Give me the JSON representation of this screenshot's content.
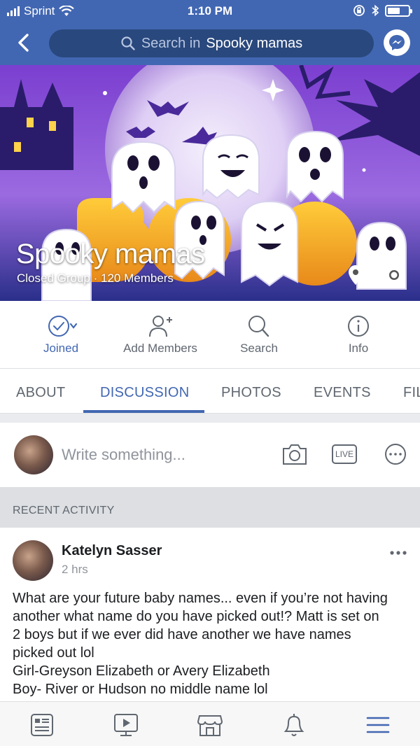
{
  "status_bar": {
    "carrier": "Sprint",
    "time": "1:10 PM",
    "battery_level": 0.6
  },
  "nav": {
    "search_prefix": "Search in",
    "search_group": "Spooky mamas"
  },
  "group": {
    "name": "Spooky mamas",
    "meta": "Closed Group · 120 Members"
  },
  "actions": [
    {
      "label": "Joined",
      "icon": "check-circle-icon"
    },
    {
      "label": "Add Members",
      "icon": "add-person-icon"
    },
    {
      "label": "Search",
      "icon": "search-icon"
    },
    {
      "label": "Info",
      "icon": "info-icon"
    }
  ],
  "tabs": [
    "ABOUT",
    "DISCUSSION",
    "PHOTOS",
    "EVENTS",
    "FIL"
  ],
  "active_tab": "DISCUSSION",
  "composer": {
    "placeholder": "Write something...",
    "live_label": "LIVE"
  },
  "recent_activity": "RECENT ACTIVITY",
  "post": {
    "author": "Katelyn Sasser",
    "time": "2 hrs",
    "lines": [
      "What are your future baby names... even if you’re not having",
      "another what name do you have picked out!? Matt is set on",
      "2 boys but if we ever did have another we have names",
      "picked out lol",
      "Girl-Greyson Elizabeth or Avery Elizabeth",
      "Boy- River or Hudson no middle name lol"
    ]
  },
  "colors": {
    "brand": "#4267b2",
    "search_pill": "#29487d",
    "muted": "#606770",
    "separator": "#dddfe2"
  }
}
